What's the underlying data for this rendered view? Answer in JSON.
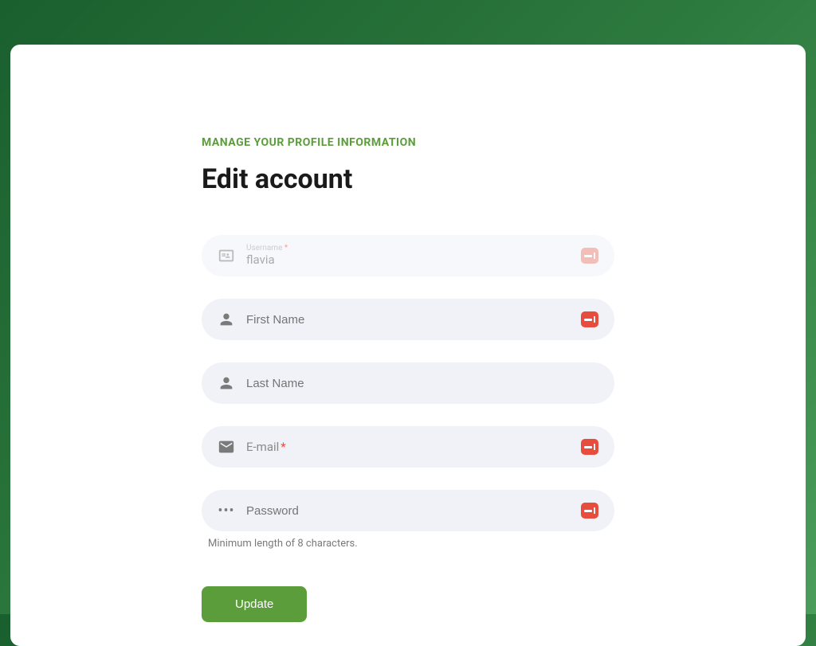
{
  "header": {
    "subtitle": "MANAGE YOUR PROFILE INFORMATION",
    "title": "Edit account"
  },
  "fields": {
    "username": {
      "label": "Username",
      "value": "flavia",
      "required": true
    },
    "first_name": {
      "placeholder": "First Name"
    },
    "last_name": {
      "placeholder": "Last Name"
    },
    "email": {
      "placeholder": "E-mail",
      "required": true
    },
    "password": {
      "placeholder": "Password",
      "helper": "Minimum length of 8 characters."
    }
  },
  "actions": {
    "update_label": "Update"
  }
}
